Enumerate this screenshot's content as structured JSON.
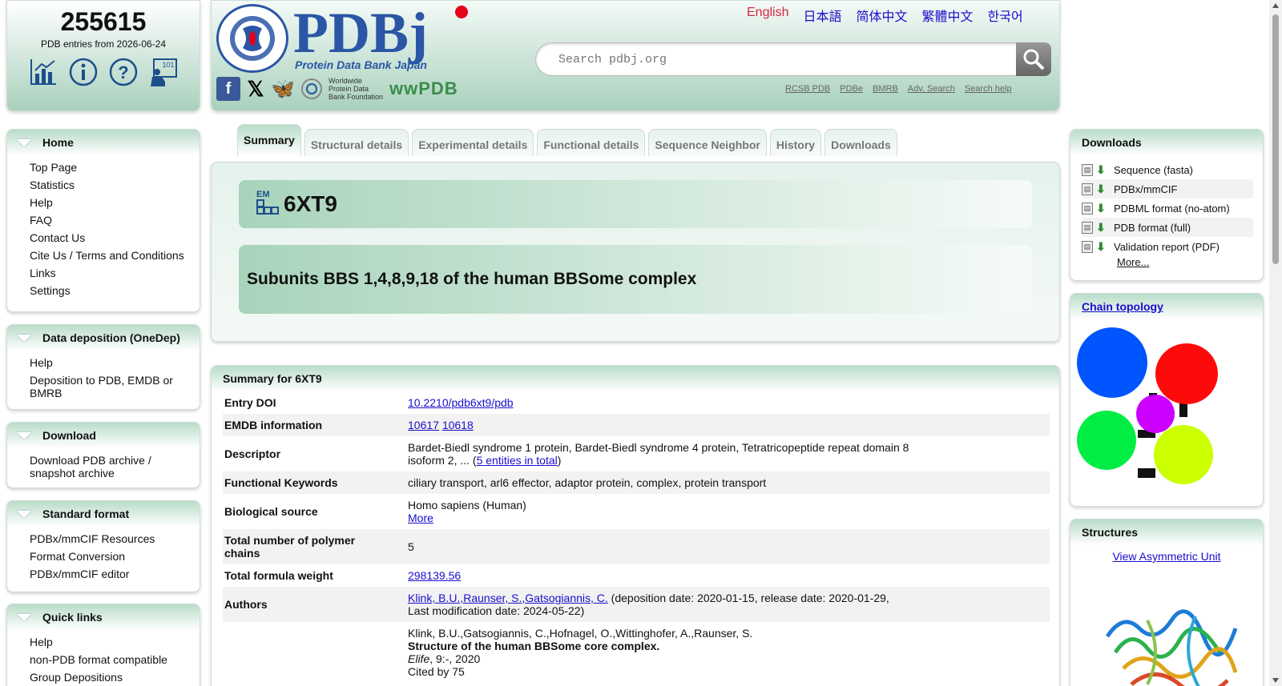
{
  "stats": {
    "count": "255615",
    "since": "PDB entries from 2026-06-24",
    "icons": [
      "statistics-chart-icon",
      "info-icon",
      "help-icon",
      "learn-101-icon"
    ]
  },
  "header": {
    "logo_text": "PDBj",
    "logo_sub": "Protein Data Bank Japan",
    "seal_text": "PROTEIN DATA BANK JAPAN",
    "wwpdb_foundation": "Worldwide Protein Data Bank Foundation",
    "wwpdb": "wwPDB",
    "languages": [
      "English",
      "日本語",
      "简体中文",
      "繁體中文",
      "한국어"
    ],
    "active_language": "English",
    "search_placeholder": "Search pdbj.org",
    "sublinks": [
      "RCSB PDB",
      "PDBe",
      "BMRB",
      "Adv. Search",
      "Search help"
    ]
  },
  "sidebar": [
    {
      "title": "Home",
      "items": [
        "Top Page",
        "Statistics",
        "Help",
        "FAQ",
        "Contact Us",
        "Cite Us / Terms and Conditions",
        "Links",
        "Settings"
      ]
    },
    {
      "title": "Data deposition (OneDep)",
      "items": [
        "Help",
        "Deposition to PDB, EMDB or BMRB"
      ]
    },
    {
      "title": "Download",
      "items": [
        "Download PDB archive / snapshot archive"
      ]
    },
    {
      "title": "Standard format",
      "items": [
        "PDBx/mmCIF Resources",
        "Format Conversion",
        "PDBx/mmCIF editor"
      ]
    },
    {
      "title": "Quick links",
      "items": [
        "Help",
        "non-PDB format compatible",
        "Group Depositions"
      ]
    }
  ],
  "tabs": [
    "Summary",
    "Structural details",
    "Experimental details",
    "Functional details",
    "Sequence Neighbor",
    "History",
    "Downloads"
  ],
  "entry": {
    "method_badge": "EM",
    "id": "6XT9",
    "title": "Subunits BBS 1,4,8,9,18 of the human BBSome complex"
  },
  "summary": {
    "heading": "Summary for 6XT9",
    "doi_label": "Entry DOI",
    "doi": "10.2210/pdb6xt9/pdb",
    "emdb_label": "EMDB information",
    "emdb": [
      "10617",
      "10618"
    ],
    "descriptor_label": "Descriptor",
    "descriptor": "Bardet-Biedl syndrome 1 protein, Bardet-Biedl syndrome 4 protein, Tetratricopeptide repeat domain 8 isoform 2, ... (",
    "descriptor_link": "5 entities in total",
    "descriptor_close": ")",
    "keywords_label": "Functional Keywords",
    "keywords": "ciliary transport, arl6 effector, adaptor protein, complex, protein transport",
    "source_label": "Biological source",
    "source": "Homo sapiens (Human)",
    "source_more": "More",
    "chains_label": "Total number of polymer chains",
    "chains": "5",
    "weight_label": "Total formula weight",
    "weight": "298139.56",
    "authors_label": "Authors",
    "authors": "Klink, B.U.,Raunser, S.,Gatsogiannis, C.",
    "dates": " (deposition date: 2020-01-15, release date: 2020-01-29, Last modification date: 2024-05-22)",
    "citation_authors": "Klink, B.U.,Gatsogiannis, C.,Hofnagel, O.,Wittinghofer, A.,Raunser, S.",
    "citation_title": "Structure of the human BBSome core complex.",
    "citation_journal": "Elife",
    "citation_detail": ", 9:-, 2020",
    "cited_by": "Cited by 75"
  },
  "right": {
    "downloads_title": "Downloads",
    "downloads": [
      "Sequence (fasta)",
      "PDBx/mmCIF",
      "PDBML format (no-atom)",
      "PDB format (full)",
      "Validation report (PDF)"
    ],
    "downloads_more": "More...",
    "topology_title": "Chain topology",
    "structures_title": "Structures",
    "view_asym": "View Asymmetric Unit"
  },
  "colors": {
    "accent_green": "#a9d1bd",
    "link": "#1a0dcc",
    "active_lang": "#d7263d",
    "topology_nodes": [
      "#0055ff",
      "#ff0a0a",
      "#cc00ff",
      "#00ee44",
      "#ccff00"
    ]
  }
}
